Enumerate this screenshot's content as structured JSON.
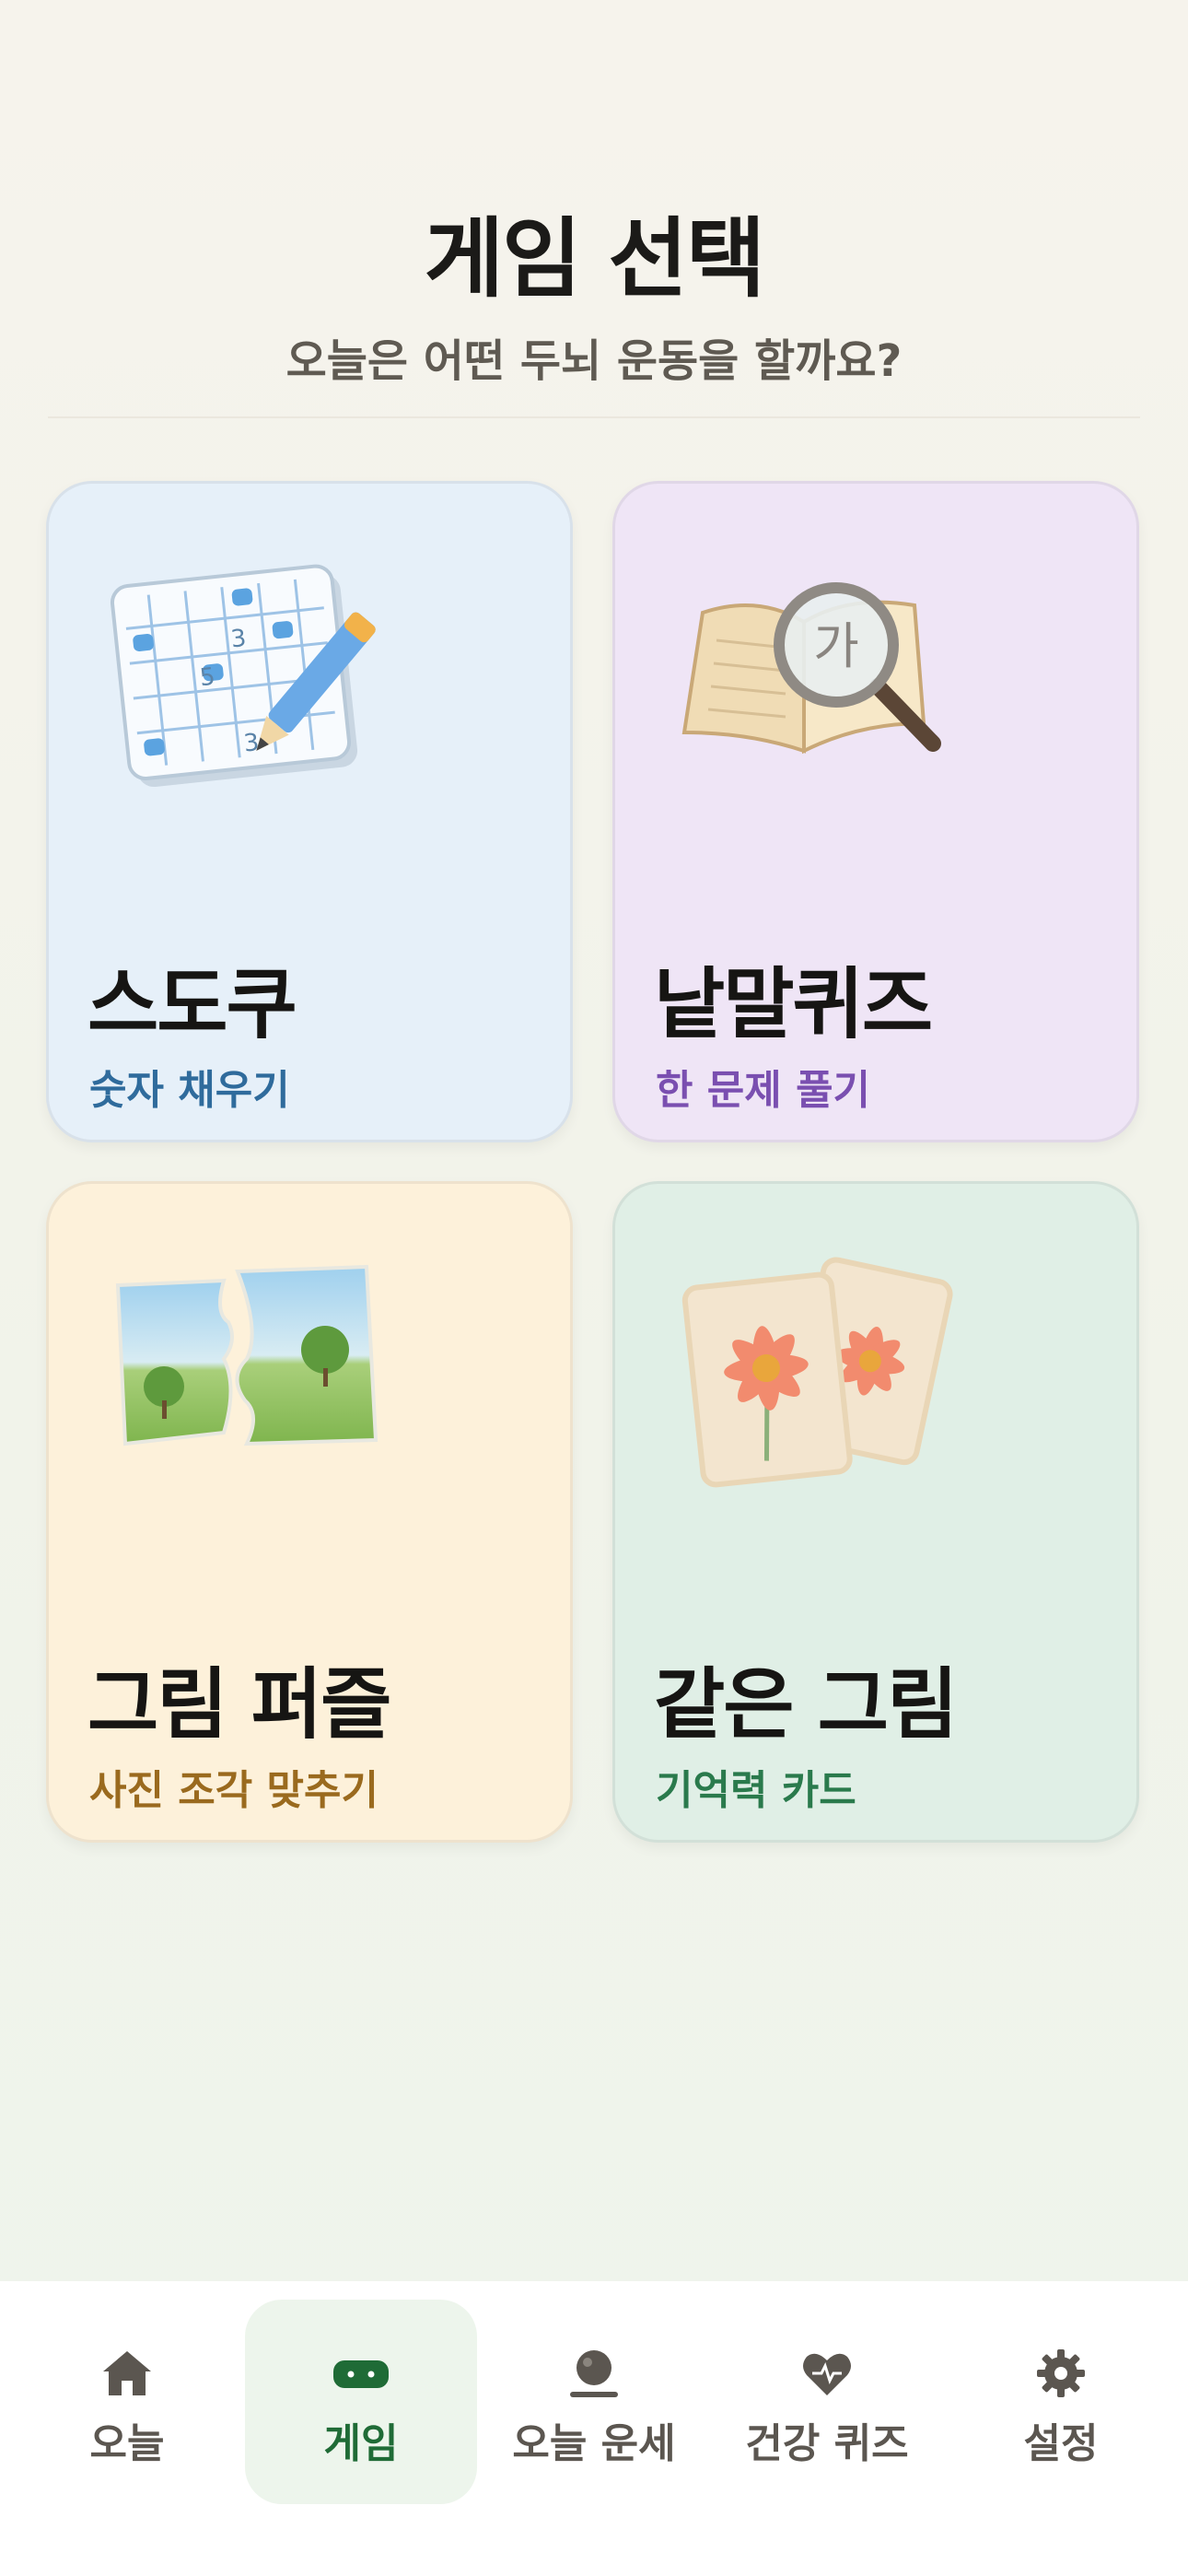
{
  "header": {
    "title": "게임 선택",
    "subtitle": "오늘은 어떤 두뇌 운동을 할까요?"
  },
  "cards": [
    {
      "title": "스도쿠",
      "subtitle": "숫자 채우기",
      "subtitle_color": "#2f6b9c",
      "icon": "sudoku-grid-icon"
    },
    {
      "title": "낱말퀴즈",
      "subtitle": "한 문제 풀기",
      "subtitle_color": "#7a4fb0",
      "icon": "book-magnifier-icon",
      "magnifier_text": "가"
    },
    {
      "title": "그림 퍼즐",
      "subtitle": "사진 조각 맞추기",
      "subtitle_color": "#9a6a1e",
      "icon": "jigsaw-landscape-icon"
    },
    {
      "title": "같은 그림",
      "subtitle": "기억력 카드",
      "subtitle_color": "#2a7a4c",
      "icon": "flower-cards-icon"
    }
  ],
  "nav": {
    "items": [
      {
        "label": "오늘",
        "icon": "home-icon"
      },
      {
        "label": "게임",
        "icon": "gamepad-icon",
        "active": true
      },
      {
        "label": "오늘 운세",
        "icon": "crystal-ball-icon"
      },
      {
        "label": "건강 퀴즈",
        "icon": "heart-pulse-icon"
      },
      {
        "label": "설정",
        "icon": "gear-icon"
      }
    ]
  },
  "colors": {
    "accent": "#1f6b36",
    "sudoku_bg": "#e6f0f9",
    "word_bg": "#efe5f6",
    "puzzle_bg": "#fdf1da",
    "memory_bg": "#e0efe6"
  }
}
